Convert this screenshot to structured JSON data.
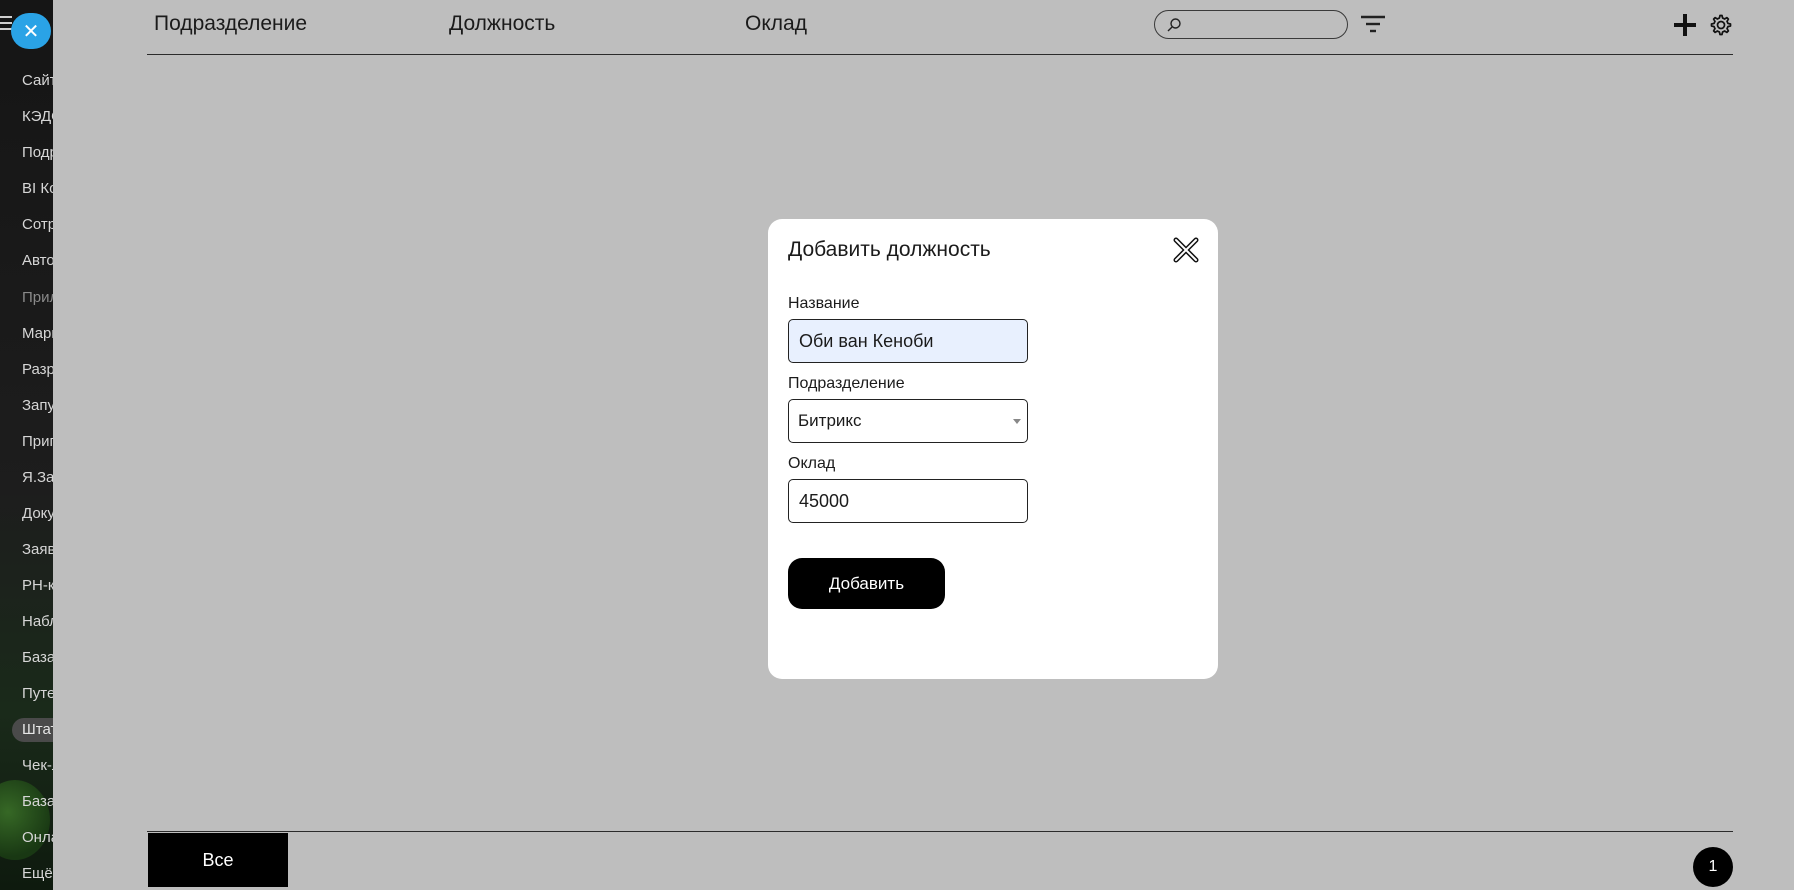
{
  "sidebar": {
    "close_symbol": "✕",
    "items": [
      {
        "label": "Сайт",
        "state": "normal"
      },
      {
        "label": "КЭДО",
        "state": "normal"
      },
      {
        "label": "Подразделения",
        "state": "normal"
      },
      {
        "label": "BI Конструктор",
        "state": "normal"
      },
      {
        "label": "Сотрудники",
        "state": "normal"
      },
      {
        "label": "Автоматизация",
        "state": "normal"
      },
      {
        "label": "Приложения",
        "state": "dim"
      },
      {
        "label": "Маркет",
        "state": "normal"
      },
      {
        "label": "Разработчикам",
        "state": "normal"
      },
      {
        "label": "Запуск",
        "state": "normal"
      },
      {
        "label": "Приглашения",
        "state": "normal"
      },
      {
        "label": "Я.Заказы",
        "state": "normal"
      },
      {
        "label": "Документы",
        "state": "normal"
      },
      {
        "label": "Заявки",
        "state": "normal"
      },
      {
        "label": "PH-контур",
        "state": "normal"
      },
      {
        "label": "Наблюдения",
        "state": "normal"
      },
      {
        "label": "База",
        "state": "normal"
      },
      {
        "label": "Путевые",
        "state": "normal"
      },
      {
        "label": "Штатное",
        "state": "active"
      },
      {
        "label": "Чек-лист",
        "state": "normal"
      },
      {
        "label": "База",
        "state": "normal"
      },
      {
        "label": "Онлайн",
        "state": "normal"
      },
      {
        "label": "Ещё",
        "state": "normal"
      }
    ]
  },
  "header": {
    "columns": [
      "Подразделение",
      "Должность",
      "Оклад"
    ],
    "search": {
      "placeholder": "",
      "value": ""
    },
    "icons": [
      "search-icon",
      "filter-icon",
      "plus-icon",
      "gear-icon"
    ]
  },
  "footer": {
    "tab_all": "Все",
    "page": "1"
  },
  "modal": {
    "title": "Добавить должность",
    "name_label": "Название",
    "name_value": "Оби ван Кеноби",
    "department_label": "Подразделение",
    "department_value": "Битрикс",
    "salary_label": "Оклад",
    "salary_value": "45000",
    "submit_label": "Добавить"
  },
  "colors": {
    "overlay_gray": "#bebebe",
    "accent_blue": "#2aa3e6",
    "button_black": "#000000",
    "autofill_blue": "#e8f0fe"
  }
}
